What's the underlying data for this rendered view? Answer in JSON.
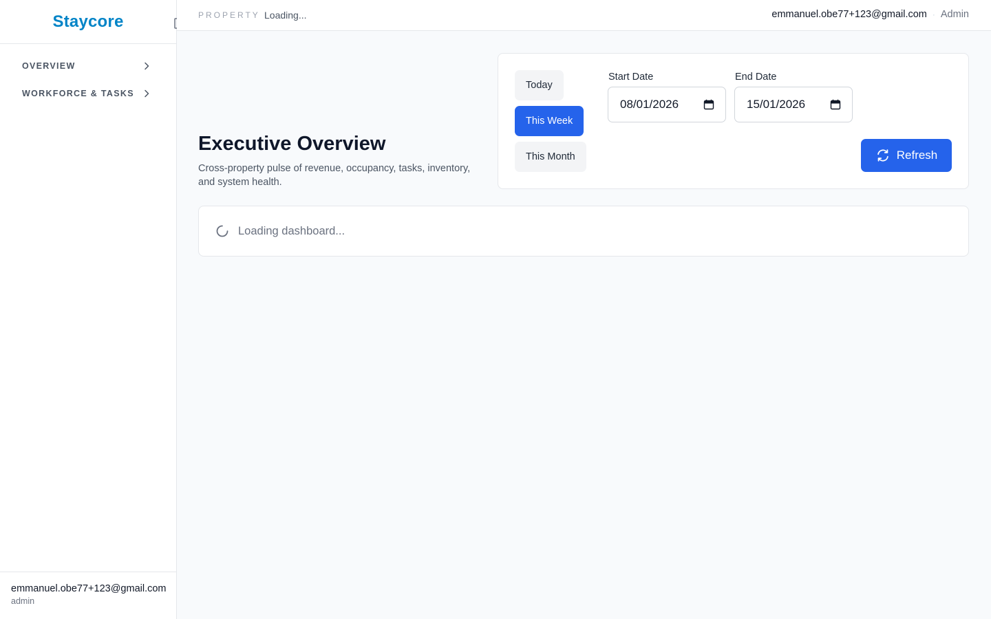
{
  "sidebar": {
    "brand": "Staycore",
    "items": [
      {
        "label": "OVERVIEW",
        "icon": "chevron-right-icon"
      },
      {
        "label": "WORKFORCE & TASKS",
        "icon": "chevron-right-icon"
      }
    ],
    "footer": {
      "email": "emmanuel.obe77+123@gmail.com",
      "role": "admin",
      "icon": "logout-icon"
    }
  },
  "topbar": {
    "property_label": "PROPERTY",
    "property_value": "Loading...",
    "user_email": "emmanuel.obe77+123@gmail.com",
    "separator": "·",
    "user_role": "Admin"
  },
  "page": {
    "title": "Executive Overview",
    "subtitle": "Cross-property pulse of revenue, occupancy, tasks, inventory, and system health."
  },
  "filters": {
    "presets": [
      {
        "label": "Today",
        "active": false
      },
      {
        "label": "This Week",
        "active": true
      },
      {
        "label": "This Month",
        "active": false
      }
    ],
    "start_date": {
      "label": "Start Date",
      "value": "08/01/2026",
      "icon": "calendar-icon"
    },
    "end_date": {
      "label": "End Date",
      "value": "15/01/2026",
      "icon": "calendar-icon"
    },
    "refresh": {
      "label": "Refresh",
      "icon": "refresh-icon"
    }
  },
  "loading": {
    "text": "Loading dashboard...",
    "icon": "spinner-icon"
  },
  "colors": {
    "brand": "#0284c7",
    "accent": "#2563eb",
    "background": "#f8fafc",
    "border": "#e5e7eb"
  }
}
